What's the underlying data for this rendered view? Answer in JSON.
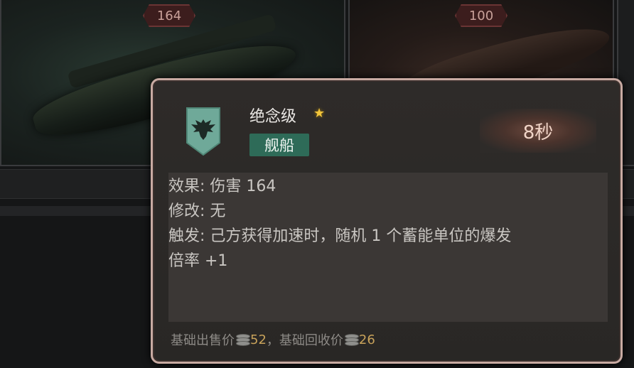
{
  "cards": [
    {
      "badge": "164"
    },
    {
      "badge": "100"
    }
  ],
  "tooltip": {
    "name": "绝念级",
    "star_icon": "star-icon",
    "type_tag": "舰船",
    "timer": "8秒",
    "emblem_icon": "eagle-emblem-icon",
    "lines": [
      "效果: 伤害 164",
      "修改: 无",
      "触发: 己方获得加速时，随机 1 个蓄能单位的爆发",
      "倍率 +1"
    ],
    "footer": {
      "sell_label": "基础出售价",
      "sell_value": "52",
      "separator": "，",
      "recycle_label": "基础回收价",
      "recycle_value": "26",
      "coin_icon": "coin-stack-icon"
    }
  },
  "colors": {
    "accent_tag": "#2e6b58",
    "star": "#f2c53b",
    "price": "#c8a25a",
    "border": "#c8aaa2"
  }
}
